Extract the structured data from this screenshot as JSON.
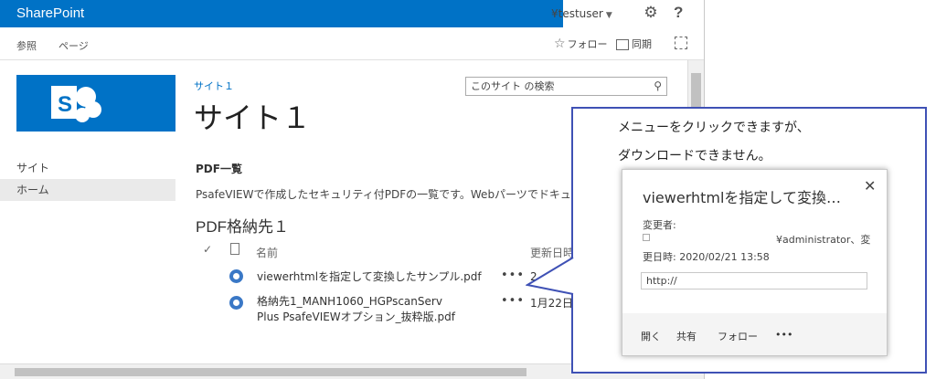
{
  "suitebar": {
    "brand": "SharePoint",
    "user": "¥testuser",
    "help": "?"
  },
  "ribbon": {
    "tabs": [
      "参照",
      "ページ"
    ],
    "follow": "フォロー",
    "sync": "同期"
  },
  "nav": {
    "items": [
      "サイト",
      "ホーム"
    ]
  },
  "site": {
    "breadcrumb": "サイト１",
    "title": "サイト１"
  },
  "search": {
    "placeholder": "このサイト の検索"
  },
  "webpart": {
    "heading": "PDF一覧",
    "description": "PsafeVIEWで作成したセキュリティ付PDFの一覧です。Webパーツでドキュメントライ"
  },
  "library": {
    "title": "PDF格納先１",
    "columns": {
      "name": "名前",
      "modified": "更新日時"
    },
    "rows": [
      {
        "name_line1": "viewerhtmlを指定して変換したサンプル.pdf",
        "name_line2": "",
        "modified": "2"
      },
      {
        "name_line1": "格納先1_MANH1060_HGPscanServ",
        "name_line2": "Plus PsafeVIEWオプション_抜粋版.pdf",
        "modified": "1月22日"
      }
    ],
    "ellipsis": "•••"
  },
  "callout": {
    "line1": "メニューをクリックできますが、",
    "line2": "ダウンロードできません。"
  },
  "card": {
    "title": "viewerhtmlを指定して変換…",
    "close": "✕",
    "modified_by_label": "変更者:",
    "modified_by": "¥administrator、変",
    "modified_at": "更日時: 2020/02/21 13:58",
    "url": "http://",
    "actions": [
      "開く",
      "共有",
      "フォロー",
      "•••"
    ]
  },
  "colors": {
    "brand_blue": "#0072c6",
    "callout_border": "#3f51b5"
  }
}
